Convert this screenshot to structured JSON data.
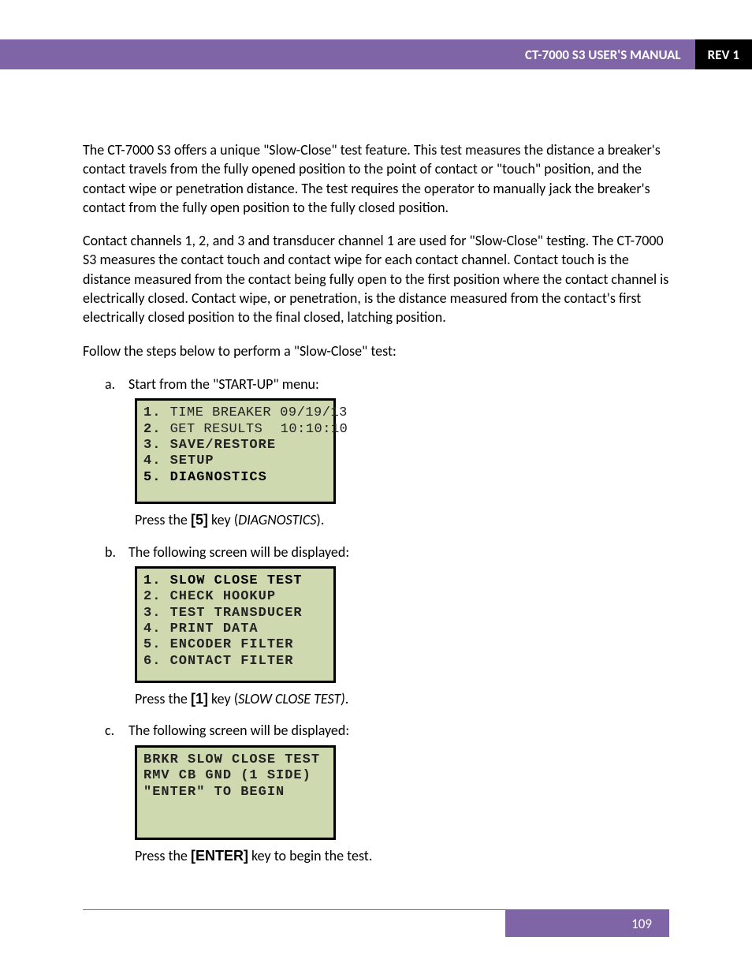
{
  "header": {
    "title": "CT-7000 S3 USER'S MANUAL",
    "rev": "REV 1"
  },
  "intro_p1": "The CT-7000 S3 offers a unique \"Slow-Close\" test feature. This test measures the distance a breaker's contact travels from the fully opened position to the point of contact or \"touch\" position, and the contact wipe or penetration distance. The test requires the operator to manually jack the breaker's contact from the fully open position to the fully closed position.",
  "intro_p2": "Contact channels 1, 2, and 3 and transducer channel 1 are used for \"Slow-Close\" testing. The CT-7000 S3 measures the contact touch and contact wipe for each contact channel. Contact touch is the distance measured from the contact being fully open to the first position where the contact channel is electrically closed. Contact wipe, or penetration, is the distance measured from the contact's first electrically closed position to the final closed, latching position.",
  "intro_p3": "Follow the steps below to perform a \"Slow-Close\" test:",
  "steps": {
    "a": {
      "marker": "a.",
      "text": "Start from the \"START-UP\" menu:",
      "lcd": {
        "l1_left": "1.",
        "l1_mid": "TIME BREAKER",
        "l1_right": "09/19/13",
        "l2_left": "2.",
        "l2_mid": "GET RESULTS",
        "l2_right": "10:10:10",
        "l3": "3. SAVE/RESTORE",
        "l4": "4. SETUP",
        "l5": "5. DIAGNOSTICS"
      },
      "press_pre": "Press the ",
      "key": "[5]",
      "press_post": " key (",
      "diag": "DIAGNOSTICS",
      "press_end": ")."
    },
    "b": {
      "marker": "b.",
      "text": "The following screen will be displayed:",
      "lcd": {
        "l1": "1. SLOW CLOSE TEST",
        "l2": "2. CHECK HOOKUP",
        "l3": "3. TEST TRANSDUCER",
        "l4": "4. PRINT DATA",
        "l5": "5. ENCODER FILTER",
        "l6": "6. CONTACT FILTER"
      },
      "press_pre": "Press the ",
      "key": "[1]",
      "press_post": " key (",
      "diag": "SLOW CLOSE TEST)",
      "press_end": "."
    },
    "c": {
      "marker": "c.",
      "text": "The following screen will be displayed:",
      "lcd": {
        "l1": "BRKR SLOW CLOSE TEST",
        "l2": "RMV CB GND (1 SIDE)",
        "l3": "",
        "l4": "",
        "l5": "\"ENTER\" TO BEGIN"
      },
      "press_pre": "Press the ",
      "key": "[ENTER]",
      "press_post": " key to begin the test."
    }
  },
  "footer": {
    "page": "109"
  }
}
